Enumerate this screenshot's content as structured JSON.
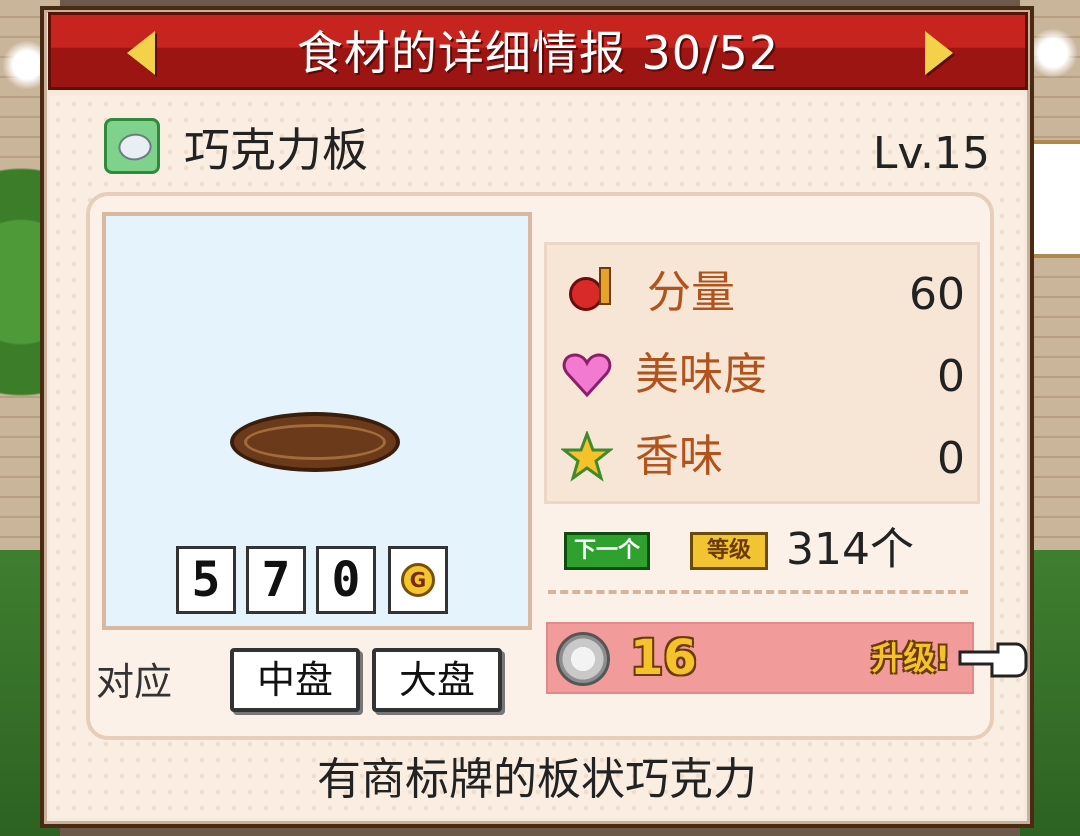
{
  "header": {
    "title": "食材的详细情报 30/52"
  },
  "item": {
    "name": "巧克力板",
    "level": "Lv.15",
    "icon": "ingredient-leaf-icon",
    "description": "有商标牌的板状巧克力"
  },
  "price": {
    "digits": [
      "5",
      "7",
      "0"
    ],
    "currency_symbol": "G"
  },
  "support": {
    "label": "对应",
    "plates": [
      "中盘",
      "大盘"
    ]
  },
  "stats": [
    {
      "label": "分量",
      "value": "60",
      "icon": "music-note-icon"
    },
    {
      "label": "美味度",
      "value": "0",
      "icon": "heart-icon"
    },
    {
      "label": "香味",
      "value": "0",
      "icon": "star-icon"
    }
  ],
  "next_level": {
    "next_tag": "下一个",
    "level_tag": "等级",
    "count": "314个"
  },
  "upgrade": {
    "medal_count": "16",
    "label": "升级!"
  },
  "colors": {
    "title_bar": "#c7231f",
    "stat_label": "#b0531c",
    "upgrade_bar": "#f29b9b",
    "gold_text": "#f5c22b"
  }
}
